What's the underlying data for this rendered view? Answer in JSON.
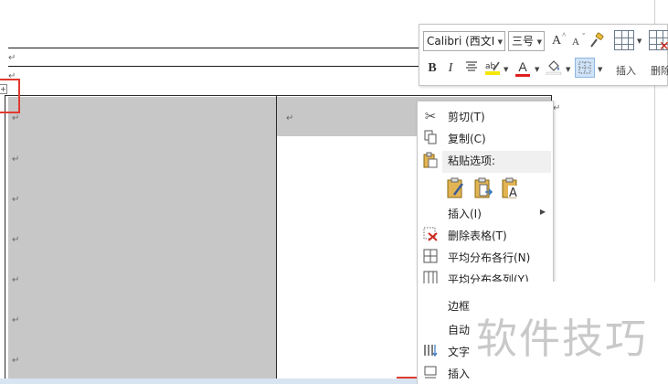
{
  "mini_toolbar": {
    "font_name": "Calibri (西文Ⅰ",
    "font_size": "三号",
    "grow_font": "A",
    "shrink_font": "A",
    "bold": "B",
    "italic": "I",
    "font_color_letter": "A",
    "insert_label": "插入",
    "delete_label": "删除"
  },
  "context_menu": {
    "items": [
      {
        "label": "剪切(T)",
        "icon": "scissors-icon"
      },
      {
        "label": "复制(C)",
        "icon": "copy-icon"
      },
      {
        "label": "粘贴选项:",
        "icon": "paste-icon"
      },
      {
        "label": "插入(I)",
        "icon": "",
        "has_submenu": true
      },
      {
        "label": "删除表格(T)",
        "icon": "delete-table-icon"
      },
      {
        "label": "平均分布各行(N)",
        "icon": "distribute-rows-icon"
      },
      {
        "label": "平均分布各列(Y)",
        "icon": "distribute-columns-icon"
      },
      {
        "label": "边框",
        "icon": ""
      },
      {
        "label": "自动",
        "icon": ""
      },
      {
        "label": "文字",
        "icon": "text-direction-icon"
      },
      {
        "label": "插入",
        "icon": "insert-caption-icon"
      }
    ],
    "paste_options": [
      "keep-source-formatting-icon",
      "merge-table-icon",
      "keep-text-only-icon"
    ]
  },
  "watermark": {
    "text": "软件技巧"
  },
  "document": {
    "table_handle": "+",
    "paragraph_mark": "↵"
  },
  "colors": {
    "highlight": "#f5e60a",
    "font_color": "#e02020",
    "cell_shade": "#c7c7c7",
    "annotation_red": "#e03a2f"
  }
}
